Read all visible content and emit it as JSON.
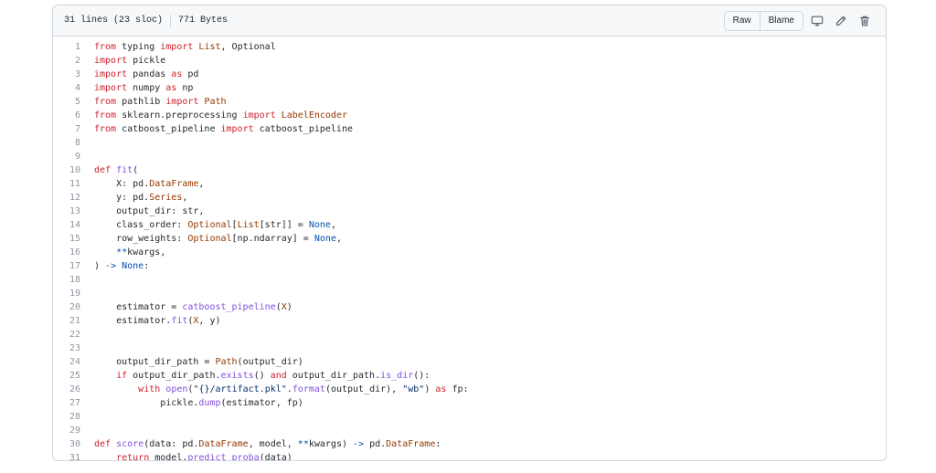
{
  "file_header": {
    "lines_info": "31 lines (23 sloc)",
    "size_info": "771 Bytes",
    "raw_label": "Raw",
    "blame_label": "Blame"
  },
  "icons": {
    "display": "desktop-icon",
    "edit": "pencil-icon",
    "delete": "trash-icon"
  },
  "code_lines": [
    {
      "n": "1",
      "t": "from typing import List, Optional"
    },
    {
      "n": "2",
      "t": "import pickle"
    },
    {
      "n": "3",
      "t": "import pandas as pd"
    },
    {
      "n": "4",
      "t": "import numpy as np"
    },
    {
      "n": "5",
      "t": "from pathlib import Path"
    },
    {
      "n": "6",
      "t": "from sklearn.preprocessing import LabelEncoder"
    },
    {
      "n": "7",
      "t": "from catboost_pipeline import catboost_pipeline"
    },
    {
      "n": "8",
      "t": ""
    },
    {
      "n": "9",
      "t": ""
    },
    {
      "n": "10",
      "t": "def fit("
    },
    {
      "n": "11",
      "t": "    X: pd.DataFrame,"
    },
    {
      "n": "12",
      "t": "    y: pd.Series,"
    },
    {
      "n": "13",
      "t": "    output_dir: str,"
    },
    {
      "n": "14",
      "t": "    class_order: Optional[List[str]] = None,"
    },
    {
      "n": "15",
      "t": "    row_weights: Optional[np.ndarray] = None,"
    },
    {
      "n": "16",
      "t": "    **kwargs,"
    },
    {
      "n": "17",
      "t": ") -> None:"
    },
    {
      "n": "18",
      "t": ""
    },
    {
      "n": "19",
      "t": ""
    },
    {
      "n": "20",
      "t": "    estimator = catboost_pipeline(X)"
    },
    {
      "n": "21",
      "t": "    estimator.fit(X, y)"
    },
    {
      "n": "22",
      "t": ""
    },
    {
      "n": "23",
      "t": ""
    },
    {
      "n": "24",
      "t": "    output_dir_path = Path(output_dir)"
    },
    {
      "n": "25",
      "t": "    if output_dir_path.exists() and output_dir_path.is_dir():"
    },
    {
      "n": "26",
      "t": "        with open(\"{}/artifact.pkl\".format(output_dir), \"wb\") as fp:"
    },
    {
      "n": "27",
      "t": "            pickle.dump(estimator, fp)"
    },
    {
      "n": "28",
      "t": ""
    },
    {
      "n": "29",
      "t": ""
    },
    {
      "n": "30",
      "t": "def score(data: pd.DataFrame, model, **kwargs) -> pd.DataFrame:"
    },
    {
      "n": "31",
      "t": "    return model.predict_proba(data)"
    }
  ]
}
